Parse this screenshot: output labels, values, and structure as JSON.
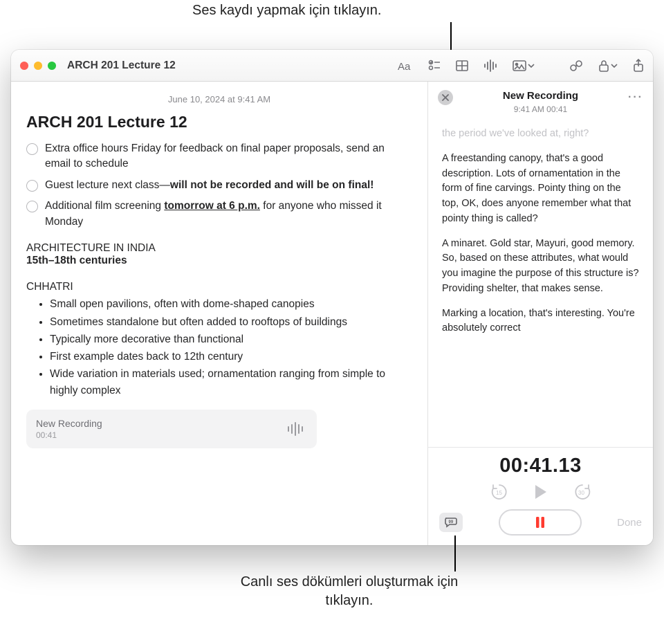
{
  "callouts": {
    "top": "Ses kaydı yapmak için tıklayın.",
    "bottom": "Canlı ses dökümleri oluşturmak için tıklayın."
  },
  "window": {
    "title": "ARCH 201 Lecture 12"
  },
  "note": {
    "timestamp": "June 10, 2024 at 9:41 AM",
    "heading": "ARCH 201 Lecture 12",
    "checklist": [
      "Extra office hours Friday for feedback on final paper proposals, send an email to schedule",
      "Guest lecture next class—<b>will not be recorded and will be on final!</b>",
      "Additional film screening <b><u>tomorrow at 6 p.m.</u></b> for anyone who missed it Monday"
    ],
    "section_title": "ARCHITECTURE IN INDIA",
    "section_sub": "15th–18th centuries",
    "subhead": "CHHATRI",
    "bullets": [
      "Small open pavilions, often with dome-shaped canopies",
      "Sometimes standalone but often added to rooftops of buildings",
      "Typically more decorative than functional",
      "First example dates back to 12th century",
      "Wide variation in materials used; ornamentation ranging from simple to highly complex"
    ],
    "recording_chip": {
      "name": "New Recording",
      "duration": "00:41"
    }
  },
  "sidebar": {
    "title": "New Recording",
    "subtitle": "9:41 AM 00:41",
    "transcript": {
      "faded": "the period we've looked at, right?",
      "p1": "A freestanding canopy, that's a good description. Lots of ornamentation in the form of fine carvings. Pointy thing on the top, OK, does anyone remember what that pointy thing is called?",
      "p2": "A minaret. Gold star, Mayuri, good memory. So, based on these attributes, what would you imagine the purpose of this structure is? Providing shelter, that makes sense.",
      "p3": "Marking a location, that's interesting. You're absolutely correct"
    },
    "timer": "00:41.13",
    "done_label": "Done"
  }
}
